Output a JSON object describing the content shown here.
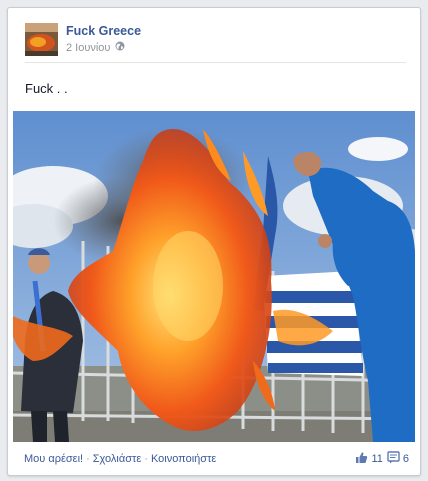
{
  "post": {
    "page_name": "Fuck Greece",
    "date": "2 Ιουνίου",
    "privacy_icon": "globe-icon",
    "text": "Fuck . ."
  },
  "footer": {
    "like_label": "Μου αρέσει!",
    "comment_label": "Σχολιάστε",
    "share_label": "Κοινοποιήστε",
    "separator": "·",
    "likes_count": "11",
    "comments_count": "6"
  },
  "colors": {
    "link": "#3b5998",
    "muted": "#90949c",
    "background": "#e9ebee"
  }
}
